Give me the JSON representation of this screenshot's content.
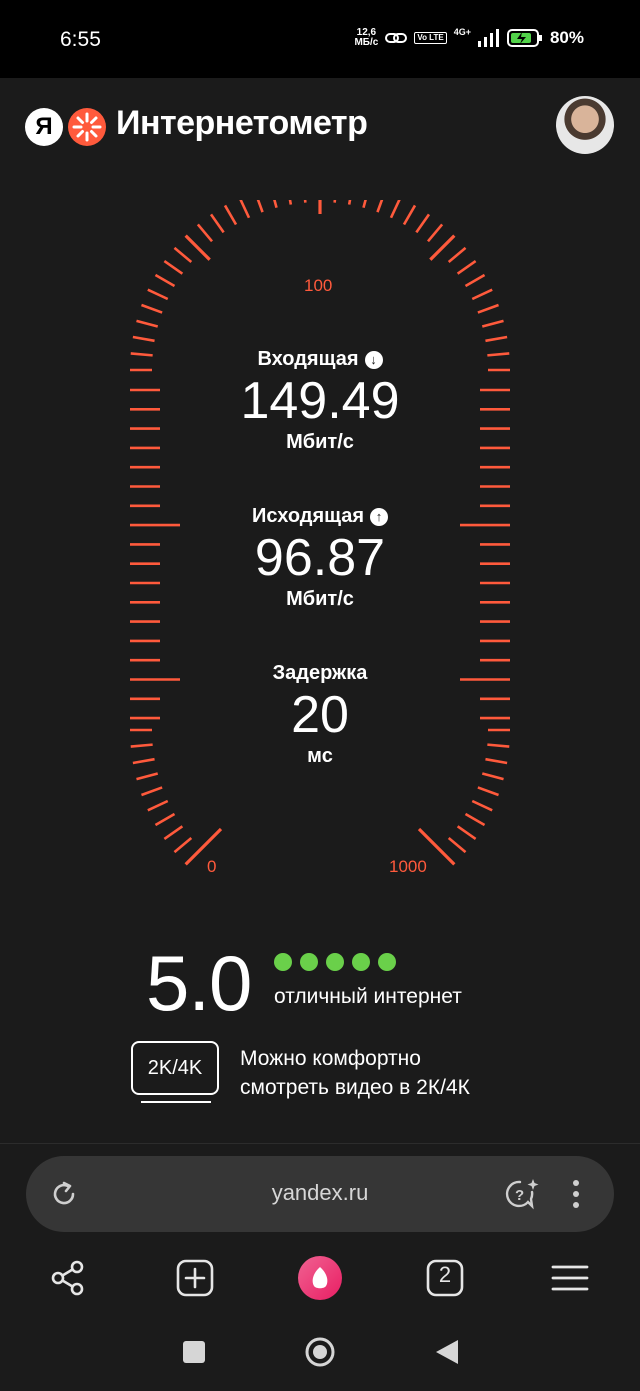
{
  "status_bar": {
    "time": "6:55",
    "net_speed_value": "12,6",
    "net_speed_unit": "МБ/с",
    "volte": "Vo LTE",
    "network": "4G+",
    "battery": "80%"
  },
  "header": {
    "logo_letter": "Я",
    "title": "Интернетометр"
  },
  "gauge": {
    "label_mid": "100",
    "label_min": "0",
    "label_max": "1000",
    "accent": "#ff5a3c"
  },
  "metrics": {
    "download": {
      "title": "Входящая",
      "icon": "arrow-down-icon",
      "value": "149.49",
      "unit": "Мбит/с"
    },
    "upload": {
      "title": "Исходящая",
      "icon": "arrow-up-icon",
      "value": "96.87",
      "unit": "Мбит/с"
    },
    "ping": {
      "title": "Задержка",
      "value": "20",
      "unit": "мс"
    }
  },
  "rating": {
    "score": "5.0",
    "stars": 5,
    "text": "отличный интернет",
    "dot_color": "#6ad04a"
  },
  "quality": {
    "badge": "2K/4K",
    "line1": "Можно комфортно",
    "line2": "смотреть видео в 2К/4К"
  },
  "browser": {
    "url": "yandex.ru",
    "tabs_count": "2"
  }
}
